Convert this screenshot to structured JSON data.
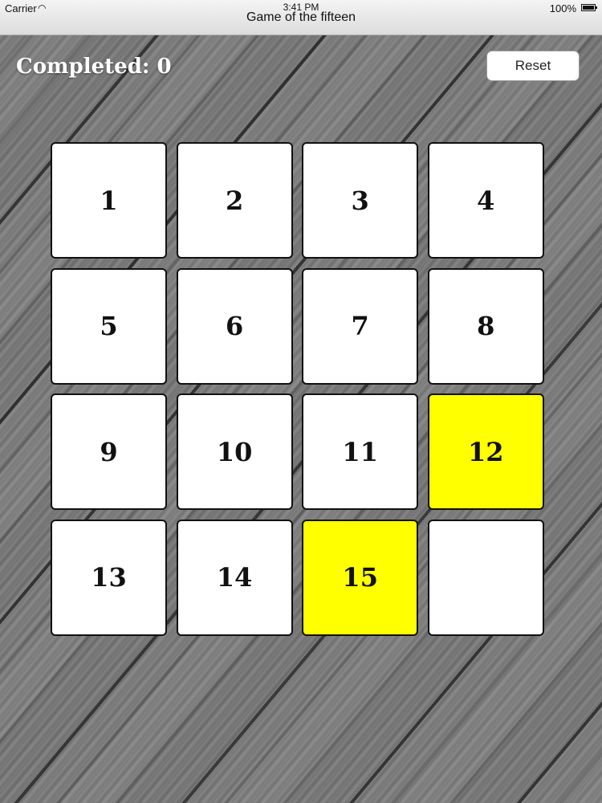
{
  "status_bar": {
    "carrier": "Carrier",
    "time": "3:41 PM",
    "battery": "100%"
  },
  "nav": {
    "title": "Game of the fifteen"
  },
  "header": {
    "completed_label": "Completed:",
    "completed_value": "0",
    "reset_label": "Reset"
  },
  "board": {
    "tiles": [
      {
        "label": "1"
      },
      {
        "label": "2"
      },
      {
        "label": "3"
      },
      {
        "label": "4"
      },
      {
        "label": "5"
      },
      {
        "label": "6"
      },
      {
        "label": "7"
      },
      {
        "label": "8"
      },
      {
        "label": "9"
      },
      {
        "label": "10"
      },
      {
        "label": "11"
      },
      {
        "label": "12",
        "highlight": true
      },
      {
        "label": "13"
      },
      {
        "label": "14"
      },
      {
        "label": "15",
        "highlight": true
      },
      {
        "label": ""
      }
    ]
  },
  "colors": {
    "highlight": "#ffff00",
    "tile": "#ffffff",
    "tile_border": "#111111"
  }
}
